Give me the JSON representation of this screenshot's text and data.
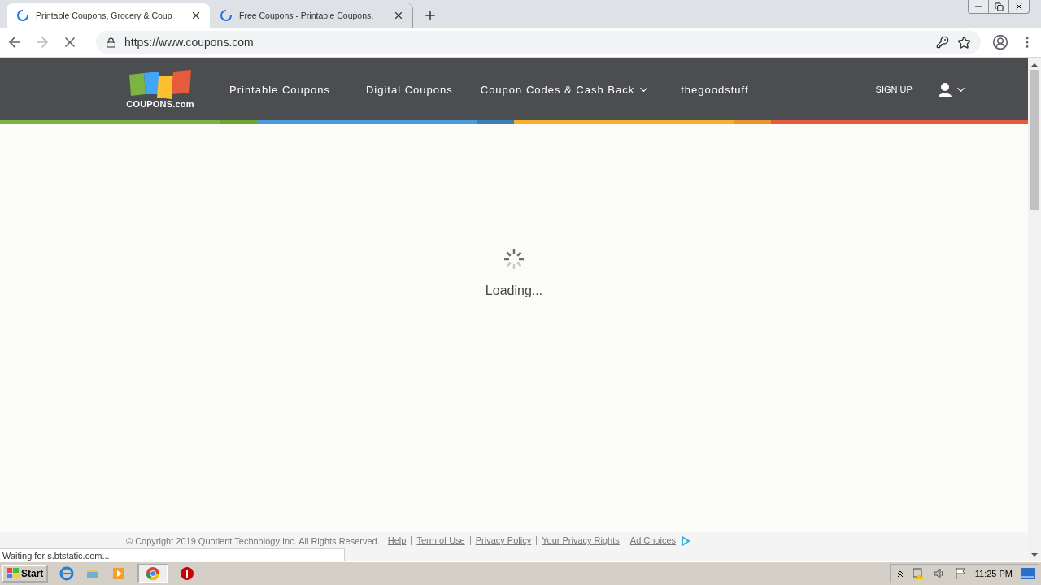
{
  "browser": {
    "tabs": [
      {
        "title": "Printable Coupons, Grocery & Coup",
        "selected": true
      },
      {
        "title": "Free Coupons - Printable Coupons,",
        "selected": false
      }
    ],
    "url": "https://www.coupons.com"
  },
  "site": {
    "logo_text": "COUPONS.com",
    "nav": [
      {
        "label": "Printable Coupons",
        "dropdown": false
      },
      {
        "label": "Digital Coupons",
        "dropdown": false
      },
      {
        "label": "Coupon Codes & Cash Back",
        "dropdown": true
      },
      {
        "label": "thegoodstuff",
        "dropdown": false
      }
    ],
    "sign_up": "SIGN UP",
    "loading_text": "Loading...",
    "footer": {
      "copyright": "© Copyright 2019 Quotient Technology Inc. All Rights Reserved.",
      "links": [
        "Help",
        "Term of Use",
        "Privacy Policy",
        "Your Privacy Rights",
        "Ad Choices"
      ]
    }
  },
  "status_text": "Waiting for s.btstatic.com...",
  "taskbar": {
    "start": "Start",
    "clock": "11:25 PM"
  }
}
